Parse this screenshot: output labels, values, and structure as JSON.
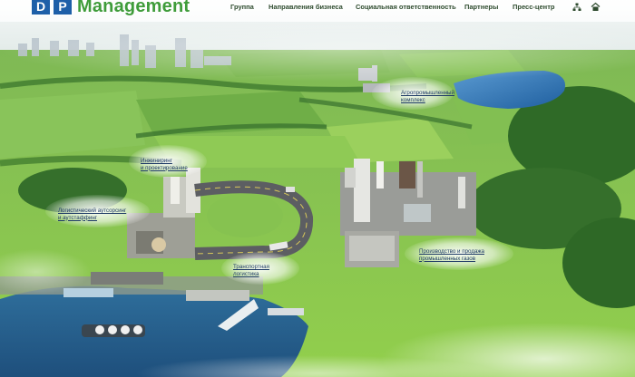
{
  "logo": {
    "letter_d": "D",
    "letter_p": "P",
    "word": "Management"
  },
  "nav": {
    "items": [
      {
        "label": "Группа"
      },
      {
        "label": "Направления бизнеса"
      },
      {
        "label": "Социальная ответственность"
      },
      {
        "label": "Партнеры"
      },
      {
        "label": "Пресс-центр"
      }
    ],
    "icons": [
      "sitemap-icon",
      "home-icon"
    ]
  },
  "map_labels": {
    "agro": "Агропромышленный\nкомплекс",
    "engineering": "Инжиниринг\nи проектирование",
    "logistics_outsourcing": "Логистический аутсорсинг\nи аутстаффинг",
    "transport": "Транспортная\nлогистика",
    "gases": "Производство и продажа\nпромышленных газов"
  },
  "colors": {
    "brand_blue": "#1e5fa8",
    "brand_green": "#3f9c3a",
    "label_text": "#1e3a66"
  }
}
